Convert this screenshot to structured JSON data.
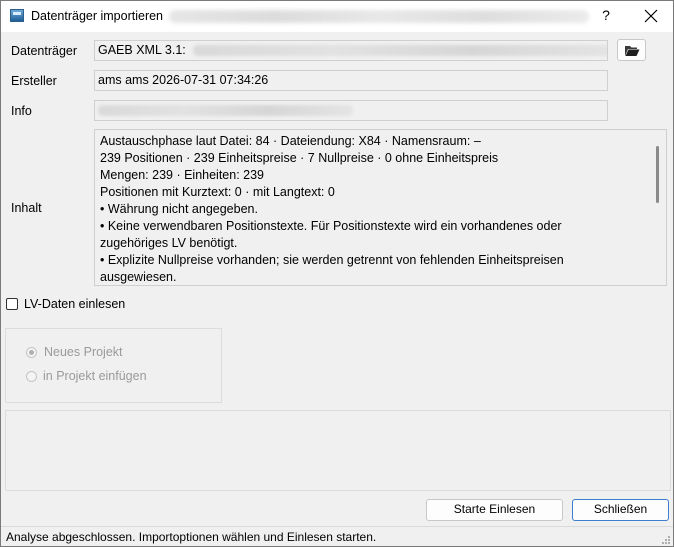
{
  "window": {
    "title": "Datenträger importieren",
    "help_glyph": "?",
    "close_glyph": "✕"
  },
  "form": {
    "datentraeger": {
      "label": "Datenträger",
      "value": "GAEB XML 3.1:"
    },
    "ersteller": {
      "label": "Ersteller",
      "value": "ams ams 2026-07-31 07:34:26"
    },
    "info": {
      "label": "Info",
      "value": ""
    },
    "inhalt": {
      "label": "Inhalt",
      "lines": [
        "Austauschphase laut Datei: 84 · Dateiendung: X84 · Namensraum: –",
        "239 Positionen · 239 Einheitspreise · 7 Nullpreise · 0 ohne Einheitspreis",
        "Mengen: 239 · Einheiten: 239",
        "Positionen mit Kurztext: 0 · mit Langtext: 0",
        "• Währung nicht angegeben.",
        "• Keine verwendbaren Positionstexte. Für Positionstexte wird ein vorhandenes oder",
        "zugehöriges LV benötigt.",
        "• Explizite Nullpreise vorhanden; sie werden getrennt von fehlenden Einheitspreisen",
        "ausgewiesen."
      ]
    }
  },
  "options": {
    "lv_checkbox_label": "LV-Daten einlesen",
    "lv_checked": false,
    "radio_neues_projekt": "Neues Projekt",
    "radio_in_projekt": "in Projekt einfügen",
    "selected": "Neues Projekt",
    "enabled": false
  },
  "buttons": {
    "start": "Starte Einlesen",
    "close": "Schließen"
  },
  "status": {
    "text": "Analyse abgeschlossen. Importoptionen wählen und Einlesen starten."
  },
  "icons": {
    "app": "dialog-app-icon",
    "folder": "folder-open-icon",
    "close": "close-icon",
    "help": "help-icon"
  },
  "colors": {
    "primary_button_border": "#3c7fd1",
    "disabled_text": "#9a9a9a"
  }
}
